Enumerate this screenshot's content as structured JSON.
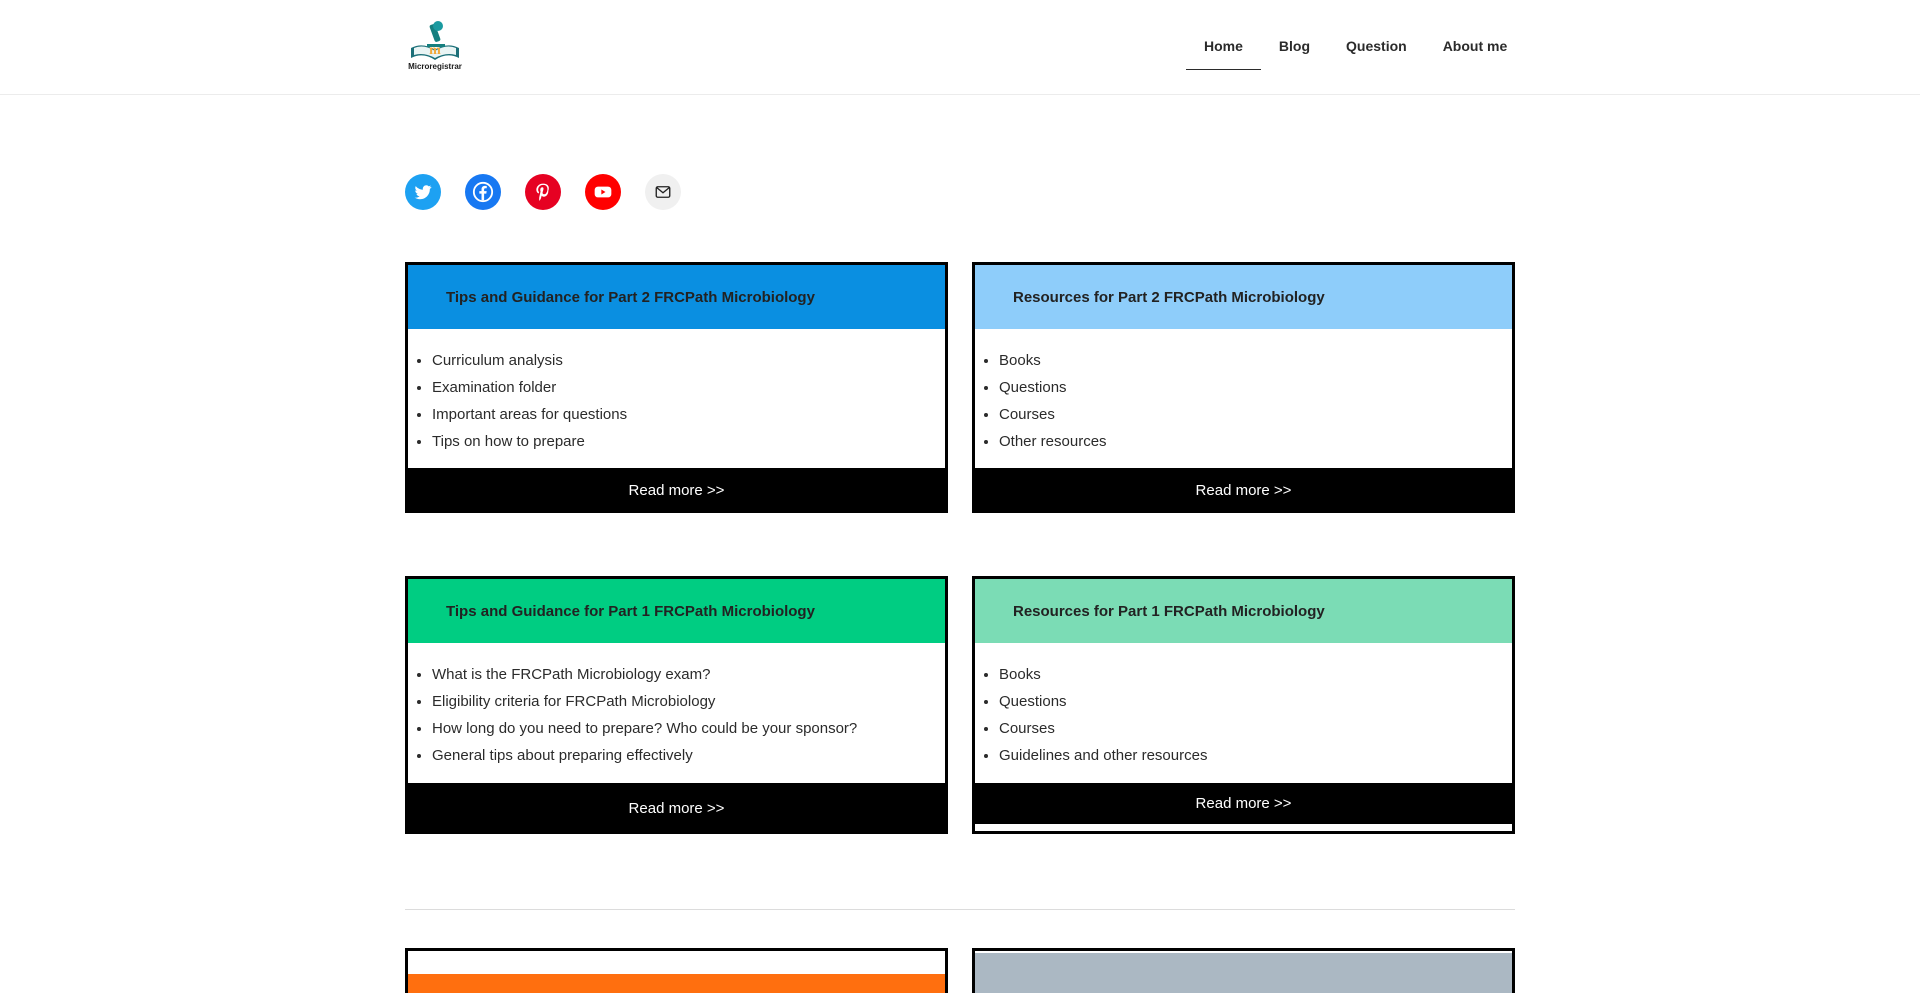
{
  "header": {
    "logo_text": "Microregistrar",
    "nav": [
      {
        "label": "Home"
      },
      {
        "label": "Blog"
      },
      {
        "label": "Question"
      },
      {
        "label": "About me"
      }
    ]
  },
  "social": [
    {
      "icon": "twitter-icon",
      "color": "#1da1f2"
    },
    {
      "icon": "facebook-icon",
      "color": "#1778f2"
    },
    {
      "icon": "pinterest-icon",
      "color": "#e60122"
    },
    {
      "icon": "youtube-icon",
      "color": "#ff0000"
    },
    {
      "icon": "mail-icon",
      "color": "#f0f0f0"
    }
  ],
  "cards": [
    {
      "title": "Tips and Guidance for Part 2 FRCPath Microbiology",
      "color": "#0a8fe1",
      "items": [
        "Curriculum analysis",
        "Examination folder",
        "Important areas for questions",
        "Tips on how to prepare"
      ],
      "button": "Read more >>"
    },
    {
      "title": "Resources for Part 2 FRCPath Microbiology",
      "color": "#8ecdfa",
      "items": [
        "Books",
        "Questions",
        "Courses",
        "Other resources"
      ],
      "button": "Read more >>"
    },
    {
      "title": "Tips and Guidance for Part 1 FRCPath Microbiology",
      "color": "#00cd82",
      "items": [
        "What is the FRCPath Microbiology exam?",
        "Eligibility criteria for FRCPath Microbiology",
        "How long do you need to prepare? Who could be your sponsor?",
        "General tips about preparing effectively"
      ],
      "button": "Read more >>"
    },
    {
      "title": "Resources for Part 1 FRCPath Microbiology",
      "color": "#7bdcb5",
      "items": [
        "Books",
        "Questions",
        "Courses",
        "Guidelines and other resources"
      ],
      "button": "Read more >>"
    },
    {
      "color": "#ff6f0f"
    },
    {
      "color": "#abb8c3"
    }
  ]
}
